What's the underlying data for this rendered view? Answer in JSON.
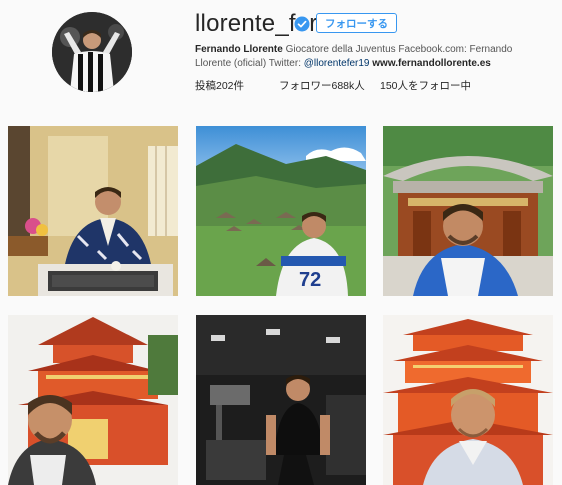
{
  "profile": {
    "username": "llorente_fer",
    "follow_label": "フォローする",
    "bio": {
      "name": "Fernando Llorente",
      "text": " Giocatore della Juventus Facebook.com: Fernando Llorente (oficial) Twitter: ",
      "mention": "@llorentefer19",
      "link": "www.fernandollorente.es"
    },
    "stats": {
      "posts": "投稿202件",
      "followers": "フォロワー688k人",
      "following": "150人をフォロー中"
    }
  },
  "colors": {
    "accent": "#3897f0",
    "text": "#262626",
    "background": "#fafafa"
  }
}
